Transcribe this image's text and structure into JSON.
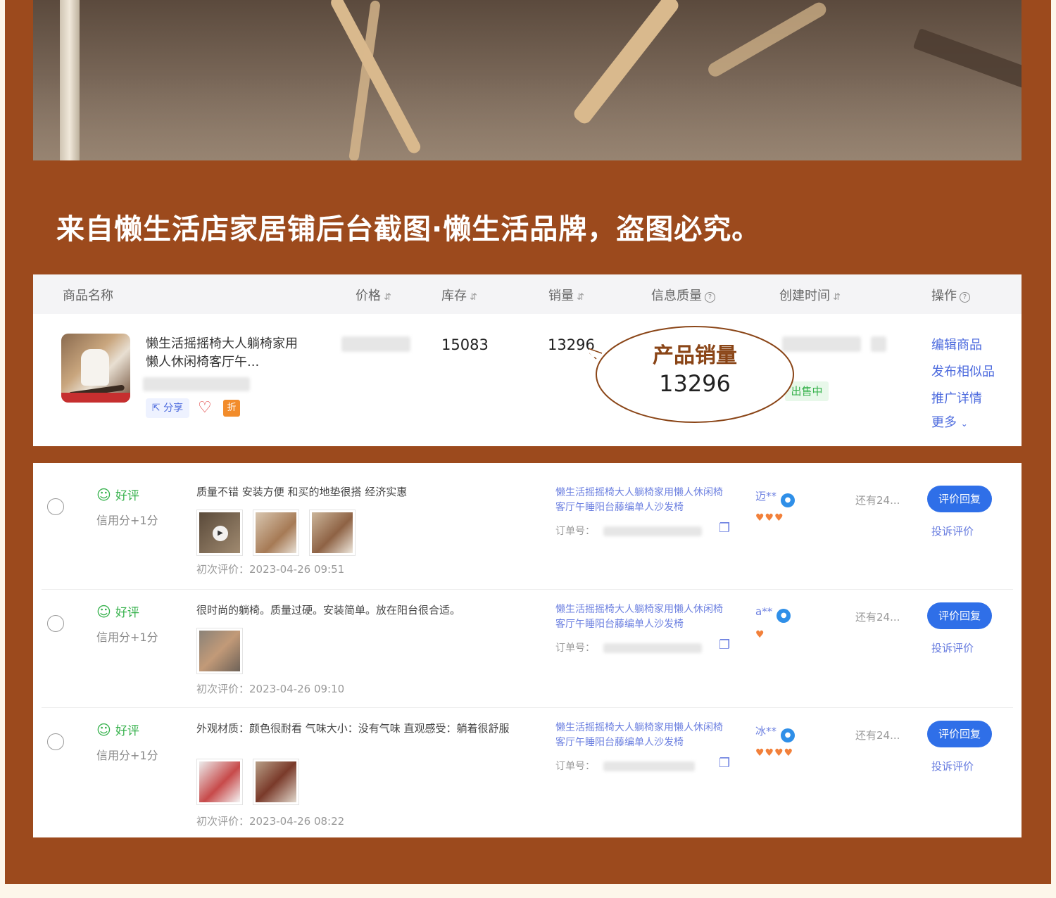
{
  "banner_caption": "来自懒生活店家居铺后台截图·懒生活品牌，盗图必究。",
  "product_table": {
    "headers": {
      "name": "商品名称",
      "price": "价格",
      "stock": "库存",
      "sales": "销量",
      "quality": "信息质量",
      "created": "创建时间",
      "ops": "操作"
    },
    "sort_icon": "⇵",
    "help_icon": "?",
    "row": {
      "name": "懒生活摇摇椅大人躺椅家用懒人休闲椅客厅午...",
      "share_label": "分享",
      "zhe_badge": "折",
      "stock": "15083",
      "sales": "13296",
      "status": "出售中",
      "ops": [
        "编辑商品",
        "发布相似品",
        "推广详情",
        "更多"
      ]
    }
  },
  "callout": {
    "title": "产品销量",
    "value": "13296",
    "color": "#8a4517"
  },
  "reviews": [
    {
      "rating": "好评",
      "credit": "信用分+1分",
      "content": "质量不错 安装方便 和买的地垫很搭 经济实惠",
      "pic_count": 3,
      "has_video": true,
      "first_review": "初次评价：2023-04-26 09:51",
      "product_link": "懒生活摇摇椅大人躺椅家用懒人休闲椅客厅午睡阳台藤编单人沙发椅",
      "order_label": "订单号：",
      "buyer": "迈**",
      "hearts": "♥♥♥",
      "remaining": "还有24...",
      "reply_label": "评价回复",
      "complain_label": "投诉评价"
    },
    {
      "rating": "好评",
      "credit": "信用分+1分",
      "content": "很时尚的躺椅。质量过硬。安装简单。放在阳台很合适。",
      "pic_count": 1,
      "has_video": false,
      "first_review": "初次评价：2023-04-26 09:10",
      "product_link": "懒生活摇摇椅大人躺椅家用懒人休闲椅客厅午睡阳台藤编单人沙发椅",
      "order_label": "订单号：",
      "buyer": "a**",
      "hearts": "♥",
      "remaining": "还有24...",
      "reply_label": "评价回复",
      "complain_label": "投诉评价"
    },
    {
      "rating": "好评",
      "credit": "信用分+1分",
      "content": "外观材质：颜色很耐看 气味大小：没有气味 直观感受：躺着很舒服",
      "pic_count": 2,
      "has_video": false,
      "first_review": "初次评价：2023-04-26 08:22",
      "product_link": "懒生活摇摇椅大人躺椅家用懒人休闲椅客厅午睡阳台藤编单人沙发椅",
      "order_label": "订单号：",
      "buyer": "冰**",
      "hearts": "♥♥♥♥",
      "remaining": "还有24...",
      "reply_label": "评价回复",
      "complain_label": "投诉评价"
    }
  ],
  "colors": {
    "frame_brown": "#9c4a1d",
    "link_blue": "#4d6bde",
    "good_green": "#37b24d",
    "reply_blue": "#2f6fe8"
  }
}
